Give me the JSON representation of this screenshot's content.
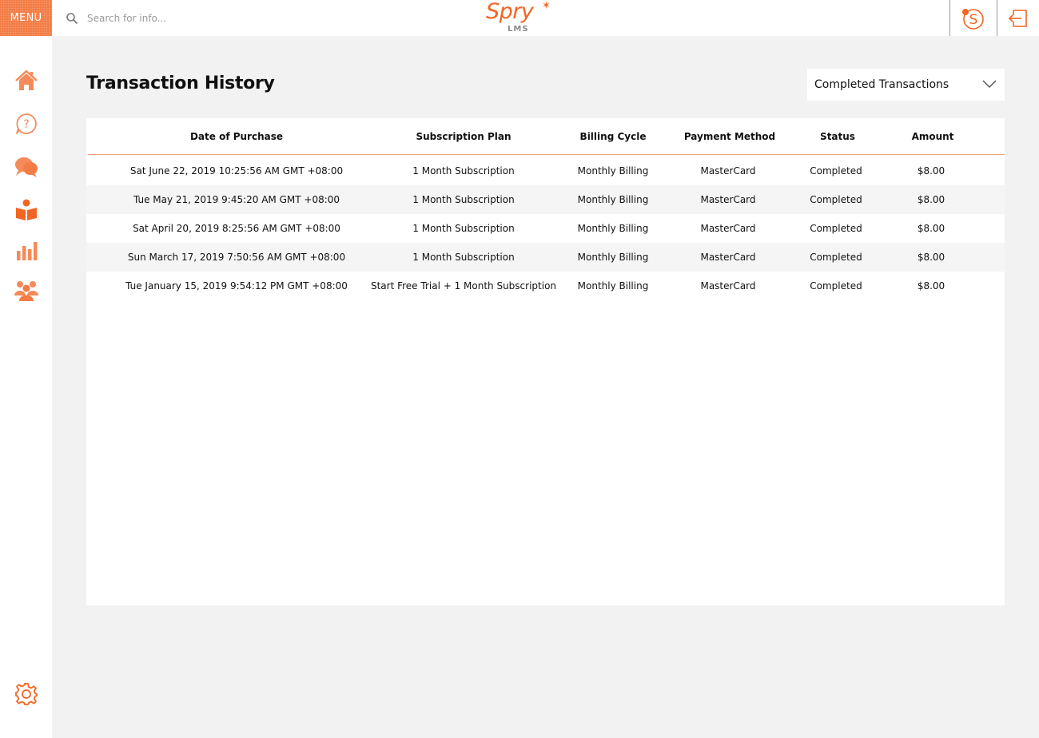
{
  "header": {
    "menu_label": "MENU",
    "search_placeholder": "Search for info...",
    "logo_text": "Spry",
    "logo_subtext": "LMS"
  },
  "sidebar": {
    "items": [
      {
        "name": "home",
        "icon": "home-icon"
      },
      {
        "name": "help",
        "icon": "question-icon"
      },
      {
        "name": "chat",
        "icon": "chat-bubbles-icon"
      },
      {
        "name": "learning",
        "icon": "reader-book-icon"
      },
      {
        "name": "reports",
        "icon": "bar-chart-icon"
      },
      {
        "name": "groups",
        "icon": "people-icon"
      },
      {
        "name": "settings",
        "icon": "gear-icon"
      }
    ]
  },
  "page": {
    "title": "Transaction History",
    "filter_selected": "Completed Transactions"
  },
  "table": {
    "headers": [
      "Date of Purchase",
      "Subscription Plan",
      "Billing Cycle",
      "Payment Method",
      "Status",
      "Amount"
    ],
    "rows": [
      [
        "Sat June 22, 2019 10:25:56 AM GMT +08:00",
        "1 Month Subscription",
        "Monthly Billing",
        "MasterCard",
        "Completed",
        "$8.00"
      ],
      [
        "Tue May 21, 2019 9:45:20 AM GMT +08:00",
        "1 Month Subscription",
        "Monthly Billing",
        "MasterCard",
        "Completed",
        "$8.00"
      ],
      [
        "Sat April 20, 2019 8:25:56 AM GMT +08:00",
        "1 Month Subscription",
        "Monthly Billing",
        "MasterCard",
        "Completed",
        "$8.00"
      ],
      [
        "Sun March 17, 2019 7:50:56 AM GMT +08:00",
        "1 Month Subscription",
        "Monthly Billing",
        "MasterCard",
        "Completed",
        "$8.00"
      ],
      [
        "Tue January 15, 2019 9:54:12 PM GMT +08:00",
        "Start Free Trial + 1 Month Subscription",
        "Monthly Billing",
        "MasterCard",
        "Completed",
        "$8.00"
      ]
    ]
  },
  "colors": {
    "accent": "#f26522",
    "menu_bg": "#f37b44",
    "header_divider": "#f4a07a",
    "page_bg": "#f2f2f2",
    "alt_row": "#f5f5f5"
  }
}
